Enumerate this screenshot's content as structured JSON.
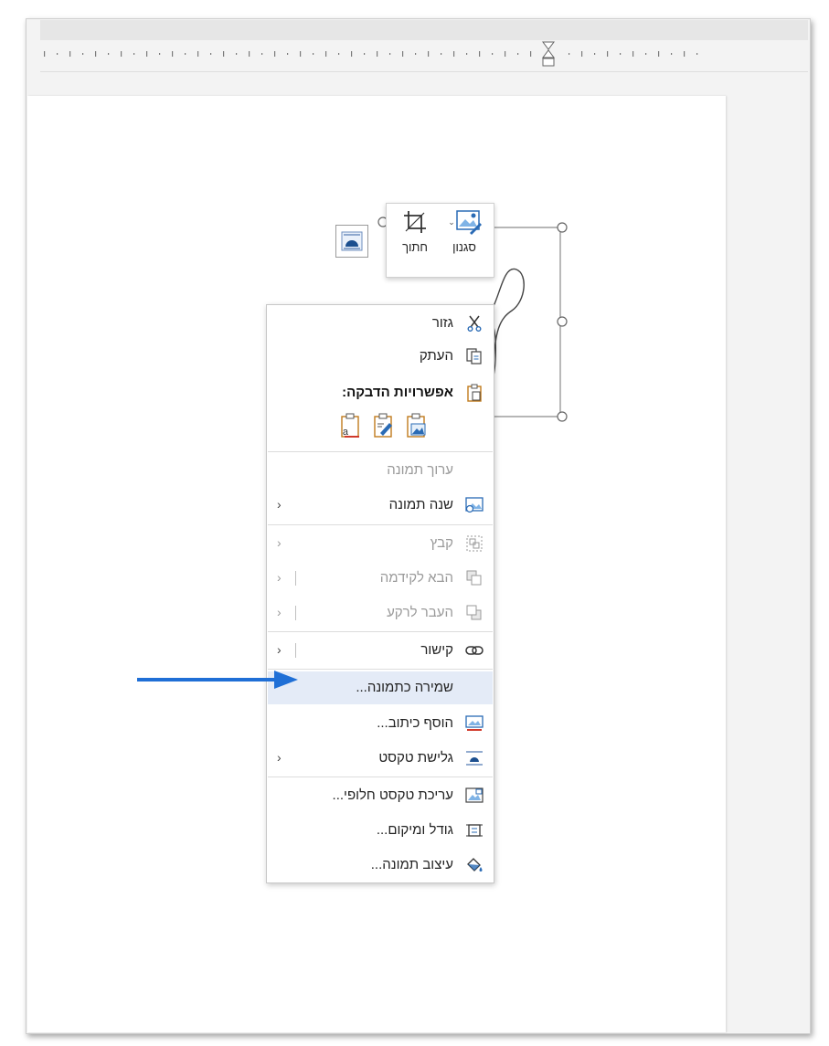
{
  "mini_toolbar": {
    "style_label": "סגנון",
    "crop_label": "חתוך"
  },
  "context_menu": {
    "cut": "גזור",
    "copy": "העתק",
    "paste_options": "אפשרויות הדבקה:",
    "edit_picture": "ערוך תמונה",
    "change_picture": "שנה תמונה",
    "group": "קבץ",
    "bring_to_front": "הבא לקידמה",
    "send_to_back": "העבר לרקע",
    "link": "קישור",
    "save_as_picture": "שמירה כתמונה...",
    "insert_caption": "הוסף כיתוב...",
    "wrap_text": "גלישת טקסט",
    "edit_alt_text": "עריכת טקסט חלופי...",
    "size_and_position": "גודל ומיקום...",
    "format_picture": "עיצוב תמונה..."
  },
  "colors": {
    "highlight": "#e4ebf7",
    "annotation_arrow": "#1f6fd6"
  }
}
